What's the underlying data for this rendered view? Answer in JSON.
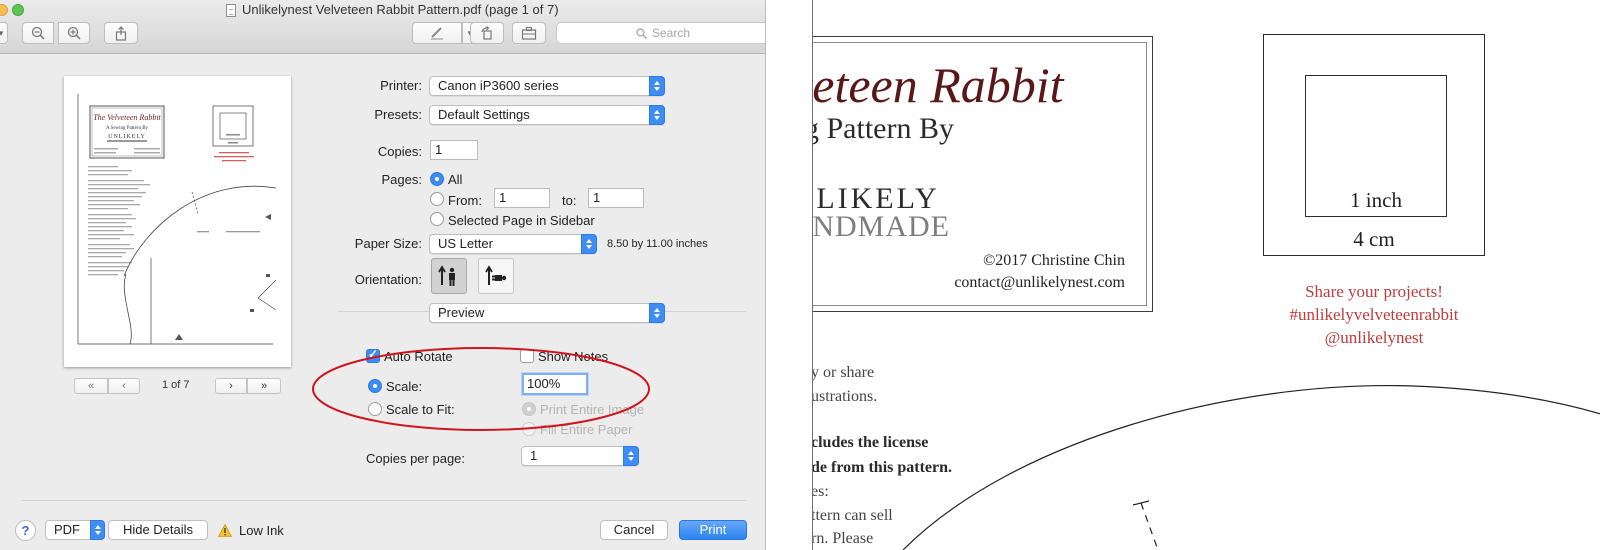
{
  "window": {
    "title": "Unlikelynest Velveteen Rabbit Pattern.pdf (page 1 of 7)",
    "search_placeholder": "Search"
  },
  "preview": {
    "page_indicator": "1 of 7",
    "thumb_title": "The Velveteen Rabbit",
    "thumb_subtitle": "A Sewing Pattern By",
    "thumb_brand": "UNLIKELY"
  },
  "form": {
    "printer_label": "Printer:",
    "printer_value": "Canon iP3600 series",
    "presets_label": "Presets:",
    "presets_value": "Default Settings",
    "copies_label": "Copies:",
    "copies_value": "1",
    "pages_label": "Pages:",
    "pages_all": "All",
    "pages_from_label": "From:",
    "pages_from_value": "1",
    "pages_to_label": "to:",
    "pages_to_value": "1",
    "pages_selected": "Selected Page in Sidebar",
    "paper_size_label": "Paper Size:",
    "paper_size_value": "US Letter",
    "paper_size_dims": "8.50 by 11.00 inches",
    "orientation_label": "Orientation:",
    "section_value": "Preview",
    "auto_rotate": "Auto Rotate",
    "show_notes": "Show Notes",
    "scale_label": "Scale:",
    "scale_value": "100%",
    "scale_to_fit_label": "Scale to Fit:",
    "print_entire_image": "Print Entire Image",
    "fill_entire_paper": "Fill Entire Paper",
    "copies_per_page_label": "Copies per page:",
    "copies_per_page_value": "1"
  },
  "footer": {
    "help": "?",
    "pdf": "PDF",
    "hide_details": "Hide Details",
    "low_ink": "Low Ink",
    "cancel": "Cancel",
    "print": "Print"
  },
  "zoom": {
    "title": "Velveteen Rabbit",
    "subtitle": "Sewing Pattern By",
    "brand_line1": "UNLIKELY",
    "brand_line2": "HANDMADE",
    "copyright": "©2017 Christine Chin",
    "contact": "contact@unlikelynest.com",
    "label_1inch": "1 inch",
    "label_4cm": "4 cm",
    "share": [
      "Share your projects!",
      "#unlikelyvelveteenrabbit",
      "@unlikelynest"
    ],
    "body_lines": [
      "y or share",
      "ustrations.",
      "cludes the license",
      "de from this pattern.",
      "es:",
      "ttern can sell",
      "rn. Please"
    ]
  },
  "colors": {
    "accent": "#3c8cf3",
    "annotation": "#d0141d",
    "title_red": "#5a1717",
    "share_red": "#c23b3b"
  }
}
